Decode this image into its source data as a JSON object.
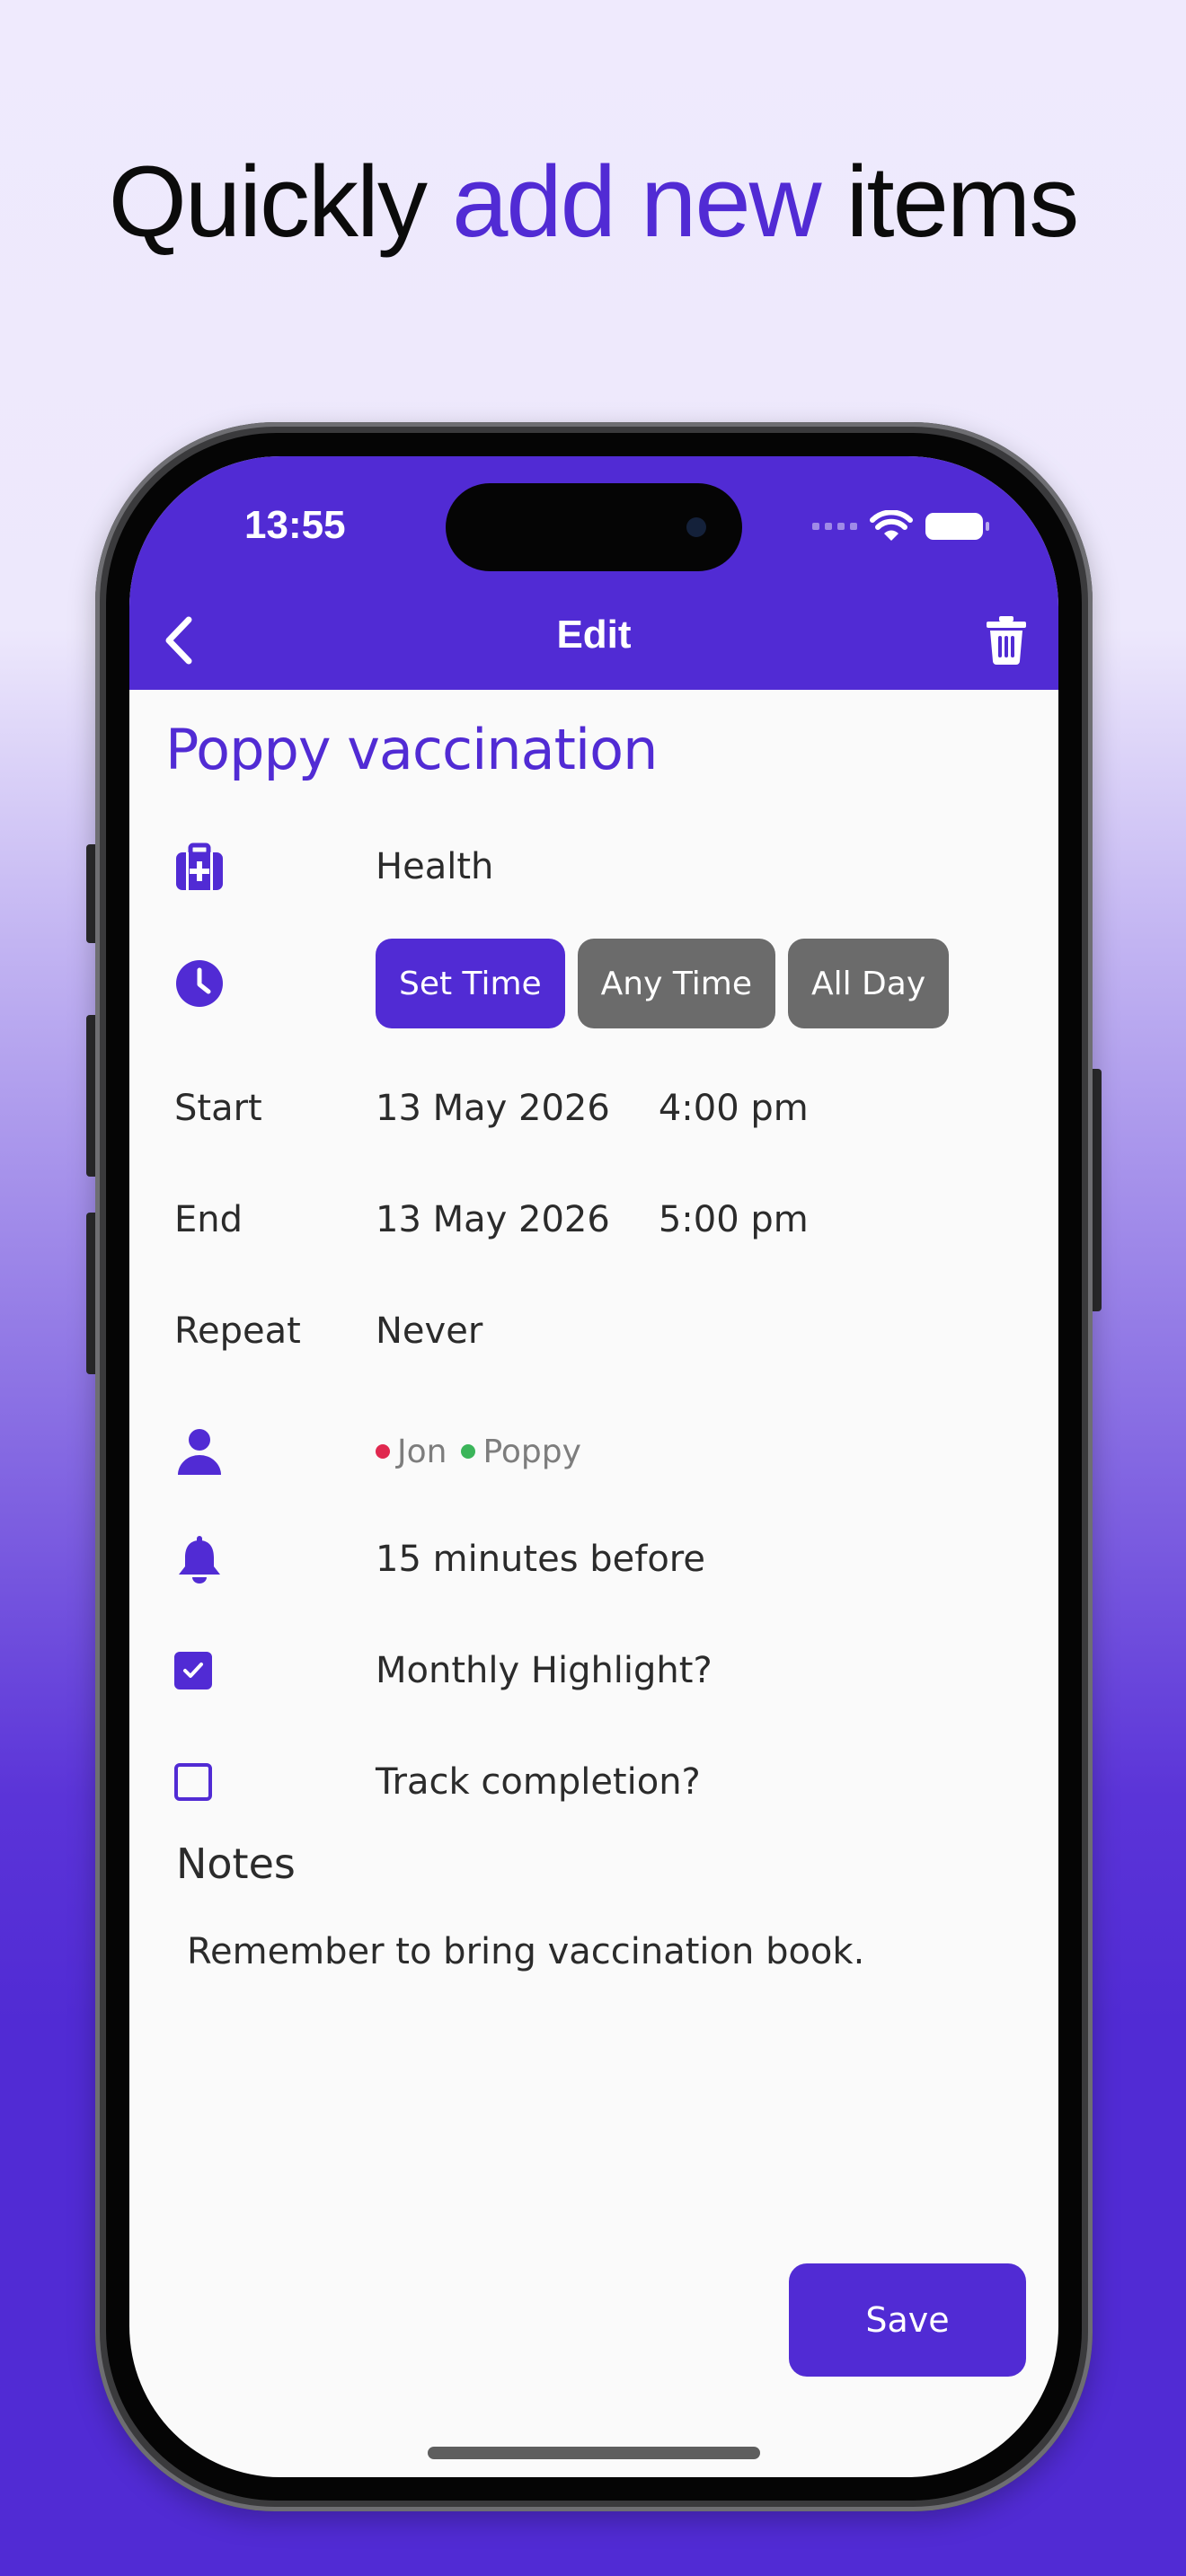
{
  "headline": {
    "part1": "Quickly ",
    "accent": "add new",
    "part2": " items"
  },
  "status_bar": {
    "time": "13:55"
  },
  "nav": {
    "title": "Edit",
    "back_icon": "chevron-left-icon",
    "delete_icon": "trash-icon"
  },
  "item": {
    "title": "Poppy vaccination"
  },
  "category": {
    "icon": "medical-kit-icon",
    "value": "Health"
  },
  "time_mode": {
    "icon": "clock-icon",
    "options": [
      {
        "label": "Set Time",
        "active": true
      },
      {
        "label": "Any Time",
        "active": false
      },
      {
        "label": "All Day",
        "active": false
      }
    ]
  },
  "start": {
    "label": "Start",
    "date": "13 May 2026",
    "time": "4:00 pm"
  },
  "end": {
    "label": "End",
    "date": "13 May 2026",
    "time": "5:00 pm"
  },
  "repeat": {
    "label": "Repeat",
    "value": "Never"
  },
  "people": {
    "icon": "person-icon",
    "members": [
      {
        "name": "Jon",
        "color": "#e0284f"
      },
      {
        "name": "Poppy",
        "color": "#3bb55a"
      }
    ]
  },
  "reminder": {
    "icon": "bell-icon",
    "value": "15 minutes before"
  },
  "monthly_highlight": {
    "label": "Monthly Highlight?",
    "checked": true
  },
  "track_completion": {
    "label": "Track completion?",
    "checked": false
  },
  "notes": {
    "heading": "Notes",
    "text": "Remember to bring vaccination book."
  },
  "actions": {
    "save_label": "Save"
  },
  "colors": {
    "accent": "#512bd4",
    "inactive_button": "#6b6b6b",
    "text": "#2b2b2b"
  }
}
